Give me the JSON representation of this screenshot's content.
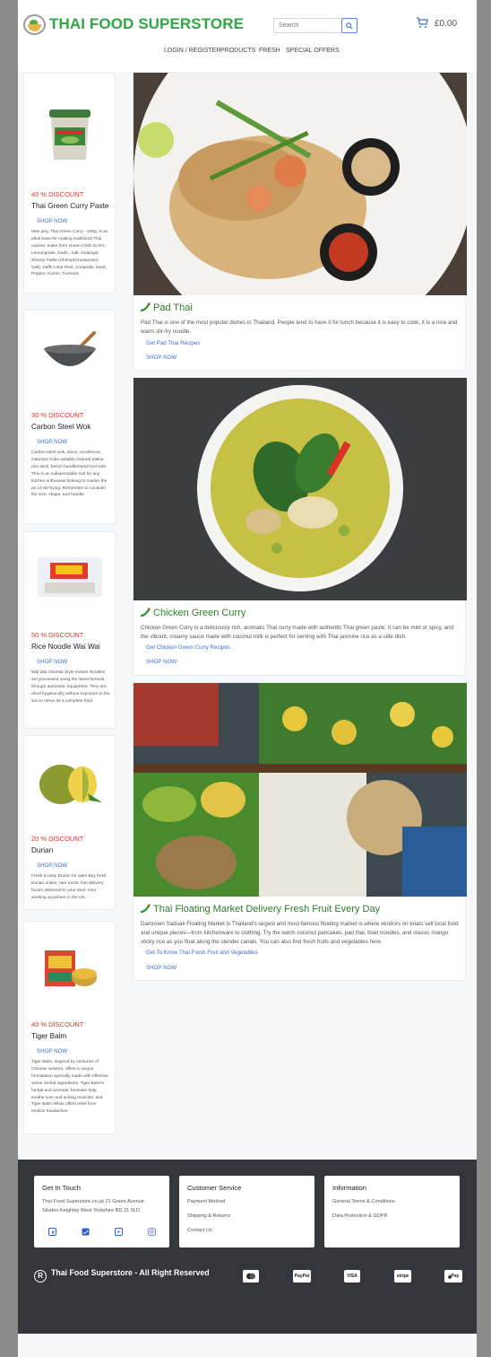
{
  "header": {
    "brand": "THAI FOOD SUPERSTORE",
    "search_placeholder": "Search",
    "cart_total": "£0.00"
  },
  "nav": [
    "LOGIN / REGISTER",
    "PRODUCTS",
    "FRESH",
    "SPECIAL OFFERS"
  ],
  "sidebar": {
    "products": [
      {
        "discount": "40 % DISCOUNT",
        "name": "Thai Green Curry Paste",
        "cta": "SHOP NOW",
        "description": "Mae ploy Thai Green Curry - 400g, is an ideal base for making traditional Thai cuisine; make from Green Chilli 31.0%, Lemongrass, Garlic, Salt, Galangal, Shrimp Paste (Shrimp(Crustacean), Salt), Kaffir Lime Peel, Coriander Seed, Pepper, Cumin, Turmeric."
      },
      {
        "discount": "30 % DISCOUNT",
        "name": "Carbon Steel Wok",
        "cta": "SHOP NOW",
        "description": "Carbon steel wok, 32cm, excellence, induction hobs suitable,/natural patina non-stick, beech handle/metal tool safe. This is an indispensable tool for any kitchen enthusiast looking to master the art of stir-frying. Remember to consider the size, shape, and handle."
      },
      {
        "discount": "50 % DISCOUNT",
        "name": "Rice Noodle Wai Wai",
        "cta": "SHOP NOW",
        "description": "Wai Wai Oriental Style Instant Noodles are processed using the latest formula through automatic equipment. They are dried hygienically without exposure to the sun to serve as a complete food."
      },
      {
        "discount": "20 % DISCOUNT",
        "name": "Durian",
        "cta": "SHOP NOW",
        "description": "Fresh & tasty Durian for sale! Buy fresh Durian online, rare exotic fruit delivery boxes delivered to your door, next working anywhere in the UK."
      },
      {
        "discount": "40 % DISCOUNT",
        "name": "Tiger Balm",
        "cta": "SHOP NOW",
        "description": "Tiger Balm, inspired by centuries of Chinese wisdom, offers a unique formulation specially made with effective active herbal ingredients. Tiger Balm's herbal and aromatic formulas help soothe sore and aching muscles, and Tiger Balm White offers relief from tension headaches."
      }
    ]
  },
  "features": [
    {
      "title": "Pad Thai",
      "description": "Pad Thai is one of the most popular dishes in Thailand. People tend to have it for lunch because it is easy to cook; it is a nice and warm stir-fry noodle.",
      "link": "Get Pad Thai Recipes",
      "cta": "SHOP NOW"
    },
    {
      "title": "Chicken Green Curry",
      "description": "Chicken Green Curry is a deliciously rich, aromatic Thai curry made with authentic Thai green paste. It can be mild or spicy, and the vibrant, creamy sauce made with coconut milk is perfect for serving with Thai jasmine rice as a side dish.",
      "link": "Get Chicken Green Curry Recipes",
      "cta": "SHOP NOW"
    },
    {
      "title": "Thai Floating Market Delivery Fresh Fruit Every Day",
      "description": "Damnoen Saduak Floating Market is Thailand's largest and most famous floating market is where vendors on boats sell local food and unique pieces—from kitchenware to clothing. Try the warm coconut pancakes, pad thai, boat noodles, and classic mango sticky rice as you float along the slender canals. You can also find fresh fruits and vegetables here.",
      "link": "Get To Know Thai Fresh Fruit and Vegetables",
      "cta": "SHOP NOW"
    }
  ],
  "footer": {
    "get_in_touch": {
      "title": "Get In Touch",
      "line1": "Thai Food Superstore.co.uk 21 Green Avenue",
      "line2": "Silsden Keighley West Yorkshire BD 21 9LD"
    },
    "customer_service": {
      "title": "Customer Service",
      "items": [
        "Payment Method",
        "Shipping & Returns",
        "Contact Us"
      ]
    },
    "information": {
      "title": "Information",
      "items": [
        "General Terms & Conditions",
        "Data Protection & GDPR"
      ]
    },
    "copyright": "Thai Food Superstore - All Right Reserved",
    "registered_mark": "R",
    "payments": [
      "PayPal",
      "VISA",
      "stripe",
      "Pay"
    ],
    "social_icons": [
      "facebook-icon",
      "twitter-icon",
      "youtube-icon",
      "instagram-icon"
    ]
  },
  "colors": {
    "brand": "#2fa843",
    "discount": "#e0322b",
    "link": "#3d6fd1",
    "footer_bg": "#33363a",
    "feature_title": "#2c7d2a"
  }
}
